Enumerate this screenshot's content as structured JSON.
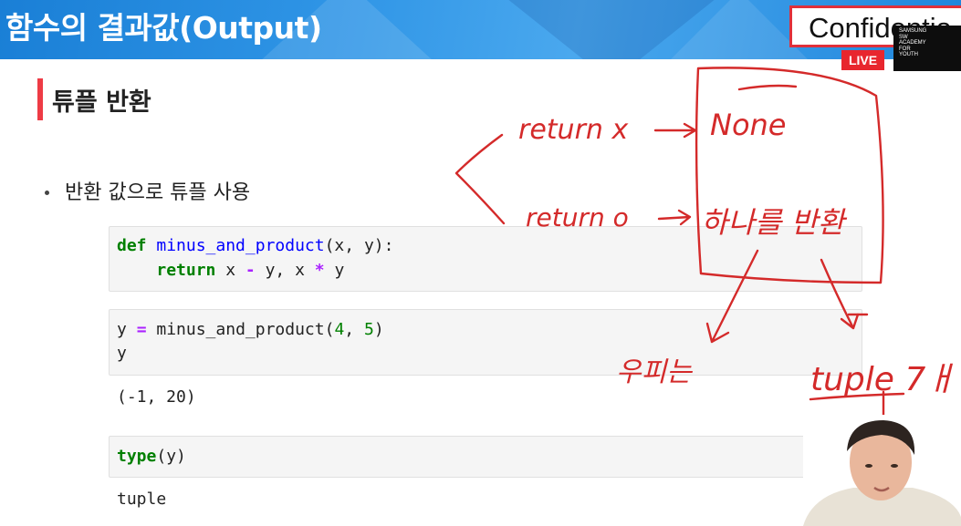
{
  "header": {
    "title": "함수의 결과값(Output)",
    "confidential_label": "Confidentia",
    "live_badge": "LIVE",
    "logo_lines": [
      "SAMSUNG",
      "SW",
      "ACADEMY",
      "FOR",
      "YOUTH"
    ]
  },
  "section": {
    "title": "튜플 반환",
    "bullet": "반환 값으로 튜플 사용"
  },
  "cells": [
    {
      "lines": [
        [
          {
            "t": "def",
            "c": "kw"
          },
          {
            "t": " "
          },
          {
            "t": "minus_and_product",
            "c": "fn"
          },
          {
            "t": "(x, y):"
          }
        ],
        [
          {
            "t": "    "
          },
          {
            "t": "return",
            "c": "kw"
          },
          {
            "t": " x "
          },
          {
            "t": "-",
            "c": "op"
          },
          {
            "t": " y, x "
          },
          {
            "t": "*",
            "c": "op"
          },
          {
            "t": " y"
          }
        ]
      ]
    },
    {
      "lines": [
        [
          {
            "t": "y "
          },
          {
            "t": "=",
            "c": "op"
          },
          {
            "t": " minus_and_product("
          },
          {
            "t": "4",
            "c": "num"
          },
          {
            "t": ", "
          },
          {
            "t": "5",
            "c": "num"
          },
          {
            "t": ")"
          }
        ],
        [
          {
            "t": "y"
          }
        ]
      ],
      "output": "(-1, 20)"
    },
    {
      "lines": [
        [
          {
            "t": "type",
            "c": "kw2"
          },
          {
            "t": "(y)"
          }
        ]
      ],
      "output": "tuple"
    }
  ],
  "annotations": {
    "return_x": "return x",
    "none": "None",
    "return_o": "return o",
    "one_return": "하나를 반환",
    "korean_small": "우피는",
    "tuple_note": "tuple 7ㅐ"
  },
  "colors": {
    "header_blue": "#2f95e6",
    "accent_red": "#ee3b45",
    "ink_red": "#d42a2a",
    "keyword_green": "#008000",
    "function_blue": "#0000ff",
    "operator_purple": "#aa22ff"
  }
}
